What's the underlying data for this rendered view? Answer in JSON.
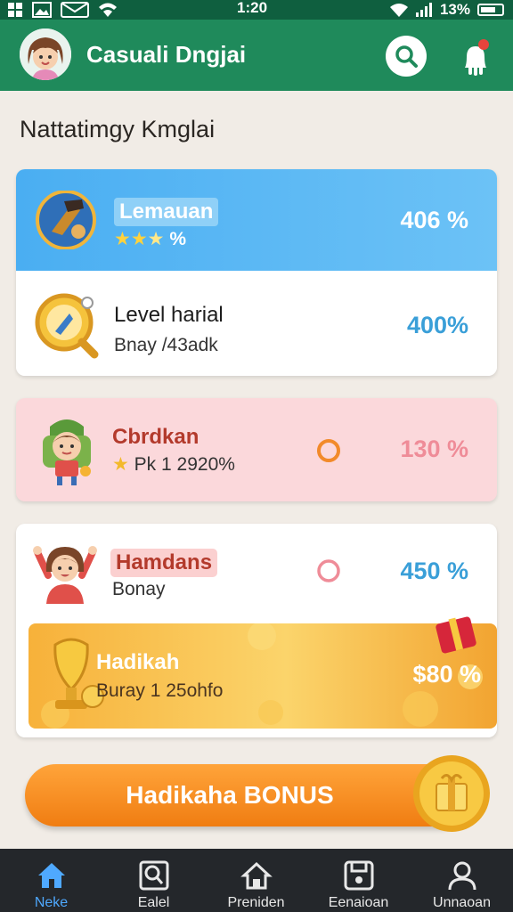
{
  "status_bar": {
    "time": "1:20",
    "battery": "13%"
  },
  "header": {
    "title": "Casuali Dngjai"
  },
  "section_title": "Nattatimgy Kmglai",
  "rows": [
    {
      "name": "Lemauan",
      "sub": "%",
      "percent": "406 %",
      "stars": 3
    },
    {
      "name": "Level harial",
      "sub": "Bnay /43adk",
      "percent": "400%"
    },
    {
      "name": "Cbrdkan",
      "sub": "Pk 1 2920%",
      "percent": "130 %"
    },
    {
      "name": "Hamdans",
      "sub": "Bonay",
      "percent": "450 %"
    },
    {
      "name": "Hadikah",
      "sub": "Buray 1 25ohfo",
      "percent": "$80 %"
    }
  ],
  "bonus_button": {
    "label": "Hadikaha BONUS"
  },
  "bottom_nav": [
    {
      "label": "Neke",
      "icon": "home-icon",
      "active": true
    },
    {
      "label": "Ealel",
      "icon": "search-square-icon",
      "active": false
    },
    {
      "label": "Preniden",
      "icon": "house-icon",
      "active": false
    },
    {
      "label": "Eenaioan",
      "icon": "save-icon",
      "active": false
    },
    {
      "label": "Unnaoan",
      "icon": "user-icon",
      "active": false
    }
  ],
  "colors": {
    "status_bar": "#0f5f3f",
    "header": "#1f8a5b",
    "blue_row": "#5ab6f2",
    "pink_row": "#fbd8db",
    "gold_row": "#f6b53a",
    "percent_blue": "#3a9fd8",
    "percent_pink": "#ef8c98",
    "bonus": "#f58a1f",
    "nav_bg": "#24272b",
    "nav_active": "#4fa9ff"
  }
}
